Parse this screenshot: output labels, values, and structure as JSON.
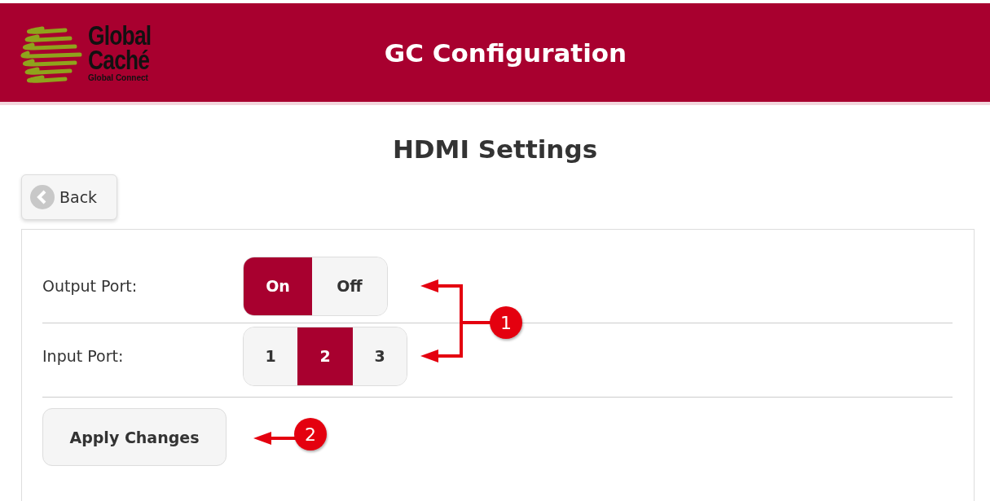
{
  "header": {
    "logo": {
      "line_1": "Global",
      "line_2": "Caché",
      "tagline": "Global Connect"
    },
    "title": "GC Configuration"
  },
  "page_title": "HDMI Settings",
  "back_button": {
    "label": "Back"
  },
  "settings": [
    {
      "kind": "toggle",
      "label": "Output Port:",
      "options": [
        {
          "label": "On",
          "selected": true
        },
        {
          "label": "Off",
          "selected": false
        }
      ]
    },
    {
      "kind": "choice",
      "label": "Input Port:",
      "options": [
        {
          "label": "1",
          "selected": false
        },
        {
          "label": "2",
          "selected": true
        },
        {
          "label": "3",
          "selected": false
        }
      ]
    }
  ],
  "apply_button": {
    "label": "Apply Changes"
  },
  "callouts": [
    {
      "number": "1"
    },
    {
      "number": "2"
    }
  ]
}
